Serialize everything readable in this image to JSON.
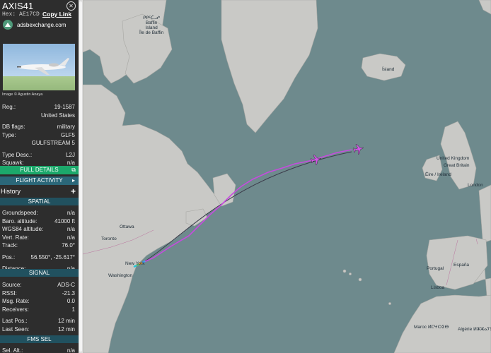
{
  "aircraft": {
    "callsign": "AXIS41",
    "hex_label": "Hex:",
    "hex": "AE17CD",
    "copy_link": "Copy Link",
    "exchange": "adsbexchange.com",
    "photo_credit": "Image © Agustin Anaya"
  },
  "info": [
    {
      "label": "Reg.:",
      "value": "19-1587"
    },
    {
      "label": "",
      "value": "United States"
    },
    {
      "label": "DB flags:",
      "value": "military"
    },
    {
      "label": "Type:",
      "value": "GLF5"
    },
    {
      "label": "",
      "value": "GULFSTREAM 5"
    },
    {
      "label": "Type Desc.:",
      "value": "L2J"
    },
    {
      "label": "Squawk:",
      "value": "n/a"
    }
  ],
  "buttons": {
    "full_details": "FULL DETAILS",
    "flight_activity": "FLIGHT ACTIVITY",
    "history": "History"
  },
  "spatial": {
    "header": "SPATIAL",
    "rows": [
      {
        "label": "Groundspeed:",
        "value": "n/a"
      },
      {
        "label": "Baro. altitude:",
        "value": "41000 ft"
      },
      {
        "label": "WGS84 altitude:",
        "value": "n/a"
      },
      {
        "label": "Vert. Rate:",
        "value": "n/a"
      },
      {
        "label": "Track:",
        "value": "76.0°"
      },
      {
        "label": "Pos.:",
        "value": "56.550°, -25.617°"
      },
      {
        "label": "Distance:",
        "value": "n/a"
      }
    ]
  },
  "signal": {
    "header": "SIGNAL",
    "rows": [
      {
        "label": "Source:",
        "value": "ADS-C"
      },
      {
        "label": "RSSI:",
        "value": "-21.3"
      },
      {
        "label": "Msg. Rate:",
        "value": "0.0"
      },
      {
        "label": "Receivers:",
        "value": "1"
      },
      {
        "label": "Last Pos.:",
        "value": "12 min"
      },
      {
        "label": "Last Seen:",
        "value": "12 min"
      }
    ]
  },
  "fms": {
    "header": "FMS SEL",
    "rows": [
      {
        "label": "Sel. Alt.:",
        "value": "n/a"
      }
    ]
  },
  "map_labels": {
    "baffin": "ᑭᑭᑦᑖᓗᒃ\nBaffin\nIsland\nÎle de Baffin",
    "island": "Ísland",
    "uk": "United Kingdom",
    "gb": "Great Britain",
    "ireland": "Éire / Ireland",
    "london": "London",
    "ottawa": "Ottawa",
    "toronto": "Toronto",
    "new_york": "New York",
    "washington": "Washington",
    "portugal": "Portugal",
    "espana": "España",
    "lisboa": "Lisboa",
    "maroc": "Maroc ⵍⵎⵖⵔⵉⴱ",
    "algerie": "Algérie ⵍⵣⵣⴰⵢⴻⵔ"
  },
  "colors": {
    "track": "#c64bdf",
    "aircraft_marker": "#d05ae6",
    "full_details_bg": "#1ca86b",
    "section_header_bg": "#21515f"
  }
}
